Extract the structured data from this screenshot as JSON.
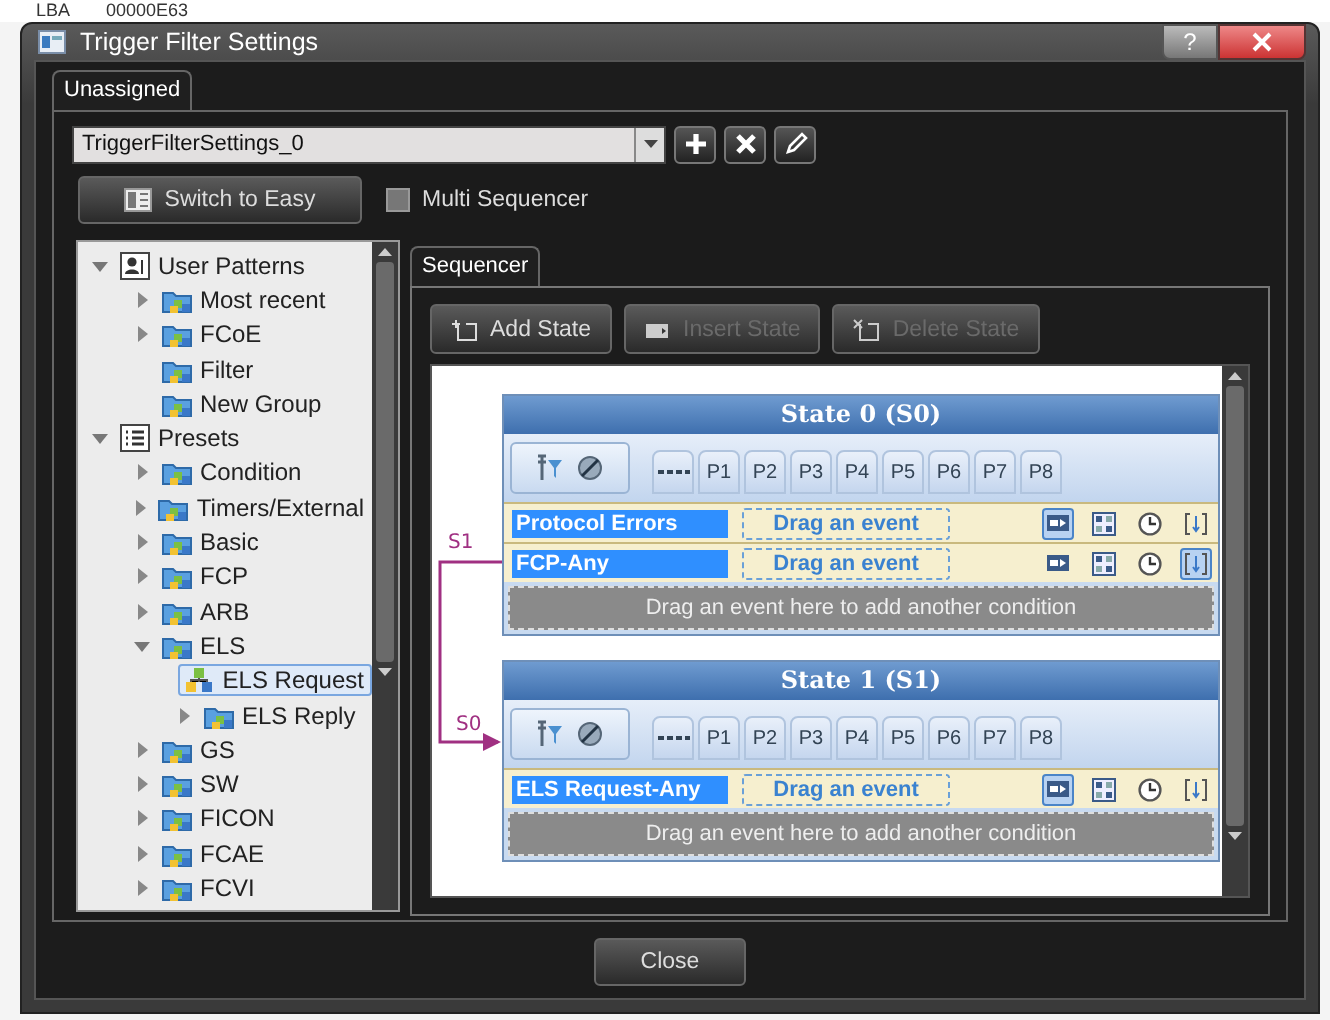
{
  "background_window": {
    "cells": [
      "LBA",
      "00000E63"
    ]
  },
  "window": {
    "title": "Trigger Filter Settings",
    "help_button": "?"
  },
  "tabs": [
    {
      "label": "Unassigned",
      "selected": true
    }
  ],
  "setting_selector": {
    "value": "TriggerFilterSettings_0"
  },
  "switch_button": "Switch to Easy",
  "multi_sequencer": {
    "label": "Multi Sequencer",
    "checked": false
  },
  "tree": [
    {
      "label": "User Patterns",
      "kind": "user-root",
      "expanded": true,
      "selected": false,
      "children": [
        {
          "label": "Most recent",
          "kind": "folder",
          "expanded": false,
          "selected": false
        },
        {
          "label": "FCoE",
          "kind": "folder",
          "expanded": false,
          "selected": false
        },
        {
          "label": "Filter",
          "kind": "folder",
          "selected": false
        },
        {
          "label": "New Group",
          "kind": "folder",
          "selected": false
        }
      ]
    },
    {
      "label": "Presets",
      "kind": "list-root",
      "expanded": true,
      "selected": false,
      "children": [
        {
          "label": "Condition",
          "kind": "folder",
          "expanded": false,
          "selected": false
        },
        {
          "label": "Timers/External",
          "kind": "folder",
          "expanded": false,
          "selected": false
        },
        {
          "label": "Basic",
          "kind": "folder",
          "expanded": false,
          "selected": false
        },
        {
          "label": "FCP",
          "kind": "folder",
          "expanded": false,
          "selected": false
        },
        {
          "label": "ARB",
          "kind": "folder",
          "expanded": false,
          "selected": false
        },
        {
          "label": "ELS",
          "kind": "folder",
          "expanded": true,
          "selected": false,
          "children": [
            {
              "label": "ELS Request",
              "kind": "pattern",
              "selected": true
            },
            {
              "label": "ELS Reply",
              "kind": "folder",
              "expanded": false,
              "selected": false
            }
          ]
        },
        {
          "label": "GS",
          "kind": "folder",
          "expanded": false,
          "selected": false
        },
        {
          "label": "SW",
          "kind": "folder",
          "expanded": false,
          "selected": false
        },
        {
          "label": "FICON",
          "kind": "folder",
          "expanded": false,
          "selected": false
        },
        {
          "label": "FCAE",
          "kind": "folder",
          "expanded": false,
          "selected": false
        },
        {
          "label": "FCVI",
          "kind": "folder",
          "expanded": false,
          "selected": false
        }
      ]
    }
  ],
  "sequencer": {
    "tabs": [
      {
        "label": "Sequencer",
        "selected": true
      }
    ],
    "toolbar": [
      {
        "label": "Add State",
        "kind": "add",
        "disabled": false
      },
      {
        "label": "Insert State",
        "kind": "insert",
        "disabled": true
      },
      {
        "label": "Delete State",
        "kind": "delete",
        "disabled": true
      }
    ],
    "states": [
      {
        "title": "State 0 (S0)",
        "patterns": [
          "P1",
          "P2",
          "P3",
          "P4",
          "P5",
          "P6",
          "P7",
          "P8"
        ],
        "conditions": [
          {
            "event": "Protocol Errors",
            "drop_label": "Drag an event",
            "actions": [
              {
                "kind": "frame",
                "on": true
              },
              {
                "kind": "grid",
                "on": false
              },
              {
                "kind": "clock",
                "on": false
              },
              {
                "kind": "bracket",
                "on": false
              }
            ]
          },
          {
            "event": "FCP-Any",
            "drop_label": "Drag an event",
            "actions": [
              {
                "kind": "frame",
                "on": false
              },
              {
                "kind": "grid",
                "on": false
              },
              {
                "kind": "clock",
                "on": false
              },
              {
                "kind": "bracket",
                "on": true
              }
            ]
          }
        ],
        "add_condition": "Drag an event here to add another condition"
      },
      {
        "title": "State 1 (S1)",
        "patterns": [
          "P1",
          "P2",
          "P3",
          "P4",
          "P5",
          "P6",
          "P7",
          "P8"
        ],
        "conditions": [
          {
            "event": "ELS Request-Any",
            "drop_label": "Drag an event",
            "actions": [
              {
                "kind": "frame",
                "on": true
              },
              {
                "kind": "grid",
                "on": false
              },
              {
                "kind": "clock",
                "on": false
              },
              {
                "kind": "bracket",
                "on": false
              }
            ]
          }
        ],
        "add_condition": "Drag an event here to add another condition"
      }
    ],
    "transitions": [
      {
        "label": "S1"
      },
      {
        "label": "S0"
      }
    ]
  },
  "close_button": "Close"
}
